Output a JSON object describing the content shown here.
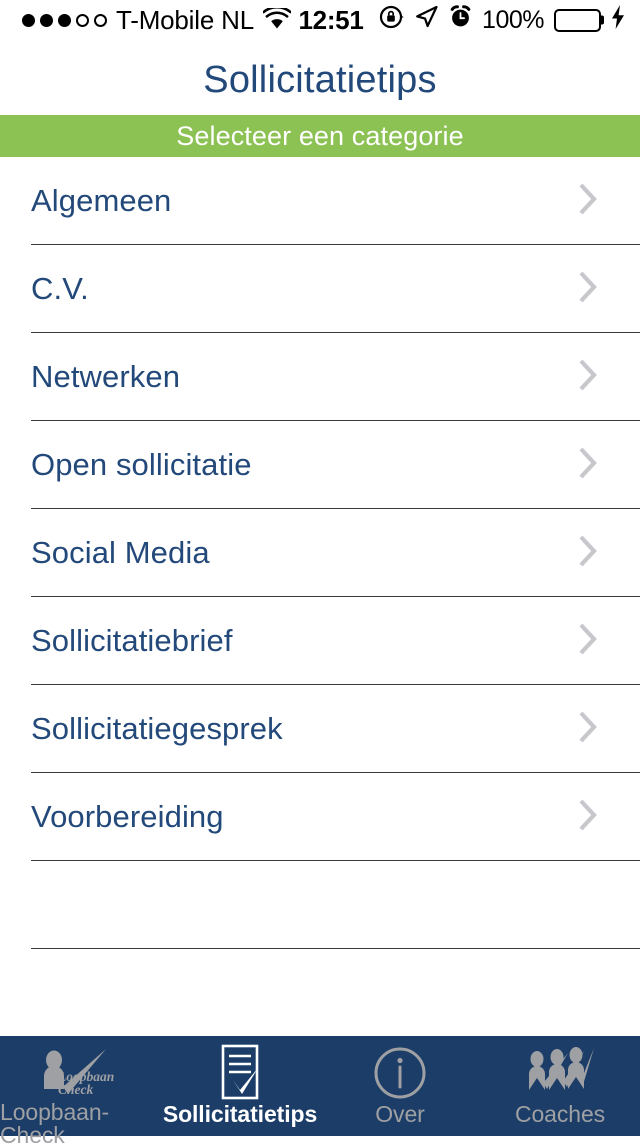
{
  "status_bar": {
    "signal_dots_filled": 3,
    "signal_dots_total": 5,
    "carrier": "T-Mobile NL",
    "wifi_icon": "wifi-icon",
    "time": "12:51",
    "rotation_lock_icon": "rotation-lock-icon",
    "location_icon": "location-arrow-icon",
    "alarm_icon": "alarm-clock-icon",
    "battery_percent": "100%",
    "battery_icon": "battery-full-icon",
    "charging_icon": "lightning-bolt-icon",
    "battery_color": "#4CD964"
  },
  "header": {
    "title": "Sollicitatietips",
    "title_color": "#23497a"
  },
  "banner": {
    "label": "Selecteer een categorie",
    "background_color": "#8CC153",
    "text_color": "#ffffff"
  },
  "list": {
    "chevron_icon": "chevron-right-icon",
    "chevron_color": "#C7C7CC",
    "item_color": "#23497a",
    "items": [
      {
        "label": "Algemeen"
      },
      {
        "label": "C.V."
      },
      {
        "label": "Netwerken"
      },
      {
        "label": "Open sollicitatie"
      },
      {
        "label": "Social Media"
      },
      {
        "label": "Sollicitatiebrief"
      },
      {
        "label": "Sollicitatiegesprek"
      },
      {
        "label": "Voorbereiding"
      },
      {
        "label": ""
      }
    ]
  },
  "tab_bar": {
    "background_color": "#1C3D68",
    "inactive_color": "#9EA0A3",
    "active_color": "#ffffff",
    "tabs": [
      {
        "label": "Loopbaan-Check",
        "icon": "loopbaan-check-logo-icon",
        "active": false
      },
      {
        "label": "Sollicitatietips",
        "icon": "document-checkmark-icon",
        "active": true
      },
      {
        "label": "Over",
        "icon": "info-circle-icon",
        "active": false
      },
      {
        "label": "Coaches",
        "icon": "three-people-checkmark-icon",
        "active": false
      }
    ],
    "logo_text_line1": "Loopbaan",
    "logo_text_line2": "Check"
  }
}
